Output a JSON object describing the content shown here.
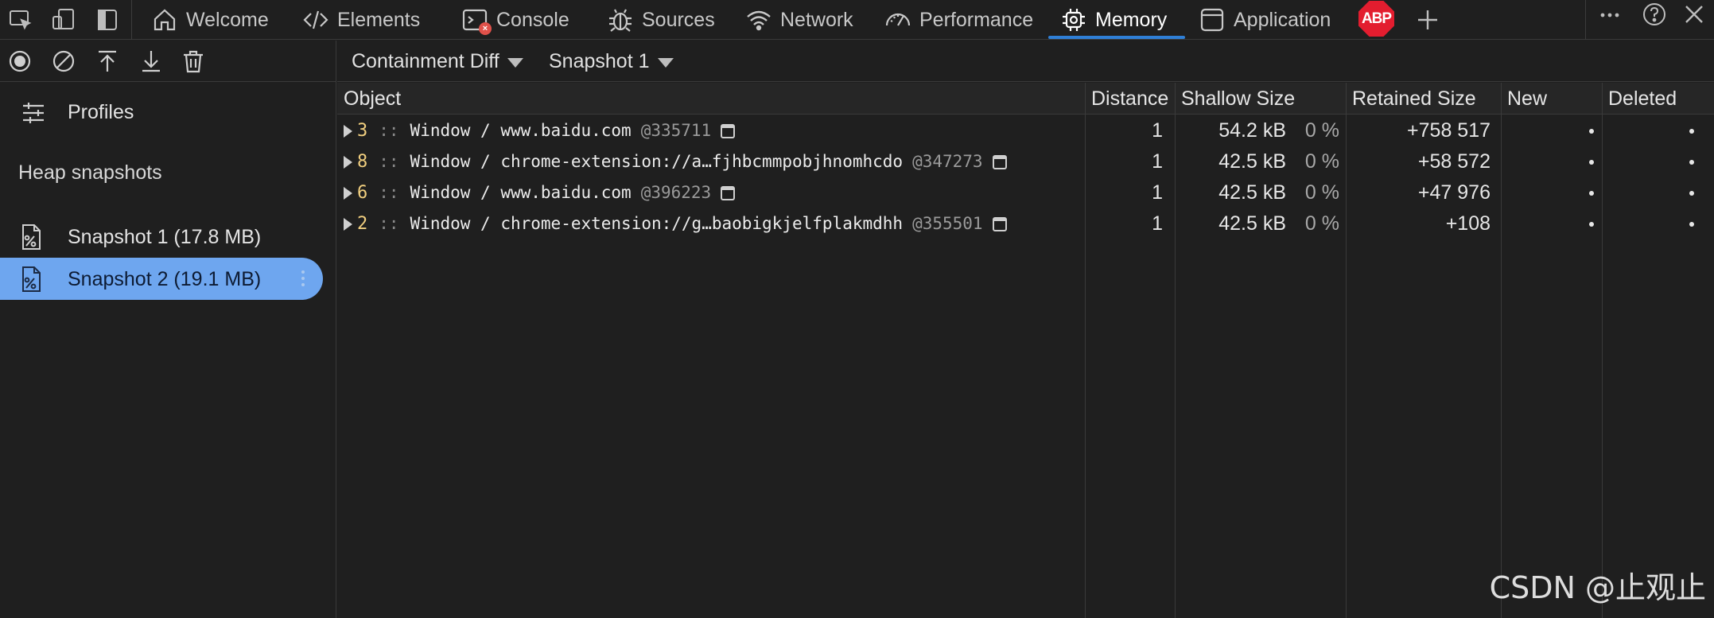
{
  "tabs": [
    {
      "label": "Welcome",
      "icon": "home-icon"
    },
    {
      "label": "Elements",
      "icon": "code-icon"
    },
    {
      "label": "Console",
      "icon": "console-icon"
    },
    {
      "label": "Sources",
      "icon": "bug-icon"
    },
    {
      "label": "Network",
      "icon": "wifi-icon"
    },
    {
      "label": "Performance",
      "icon": "gauge-icon"
    },
    {
      "label": "Memory",
      "icon": "chip-icon",
      "active": true
    },
    {
      "label": "Application",
      "icon": "app-window-icon"
    }
  ],
  "console_badge": "×",
  "abp_label": "ABP",
  "sidebar": {
    "profiles_label": "Profiles",
    "section_title": "Heap snapshots",
    "snapshots": [
      {
        "label": "Snapshot 1 (17.8 MB)"
      },
      {
        "label": "Snapshot 2 (19.1 MB)",
        "selected": true
      }
    ]
  },
  "toolbar": {
    "view_mode": "Containment Diff",
    "base_snapshot": "Snapshot 1"
  },
  "table": {
    "columns": [
      "Object",
      "Distance",
      "Shallow Size",
      "Retained Size",
      "New",
      "Deleted"
    ],
    "rows": [
      {
        "count": "3",
        "sep": "::",
        "name": "Window / www.baidu.com",
        "id": "@335711",
        "distance": "1",
        "shallow": "54.2 kB",
        "shallow_pct": "0 %",
        "retained": "+758 517"
      },
      {
        "count": "8",
        "sep": "::",
        "name": "Window / chrome-extension://a…fjhbcmmpobjhnomhcdo",
        "id": "@347273",
        "distance": "1",
        "shallow": "42.5 kB",
        "shallow_pct": "0 %",
        "retained": "+58 572"
      },
      {
        "count": "6",
        "sep": "::",
        "name": "Window / www.baidu.com",
        "id": "@396223",
        "distance": "1",
        "shallow": "42.5 kB",
        "shallow_pct": "0 %",
        "retained": "+47 976"
      },
      {
        "count": "2",
        "sep": "::",
        "name": "Window / chrome-extension://g…baobigkjelfplakmdhh",
        "id": "@355501",
        "distance": "1",
        "shallow": "42.5 kB",
        "shallow_pct": "0 %",
        "retained": "+108"
      }
    ]
  },
  "watermark": "CSDN @止观止",
  "colors": {
    "accent": "#2f7fd6",
    "selected_row": "#6ea6ef",
    "count": "#f1cf7f",
    "abp": "#e31d2f"
  }
}
